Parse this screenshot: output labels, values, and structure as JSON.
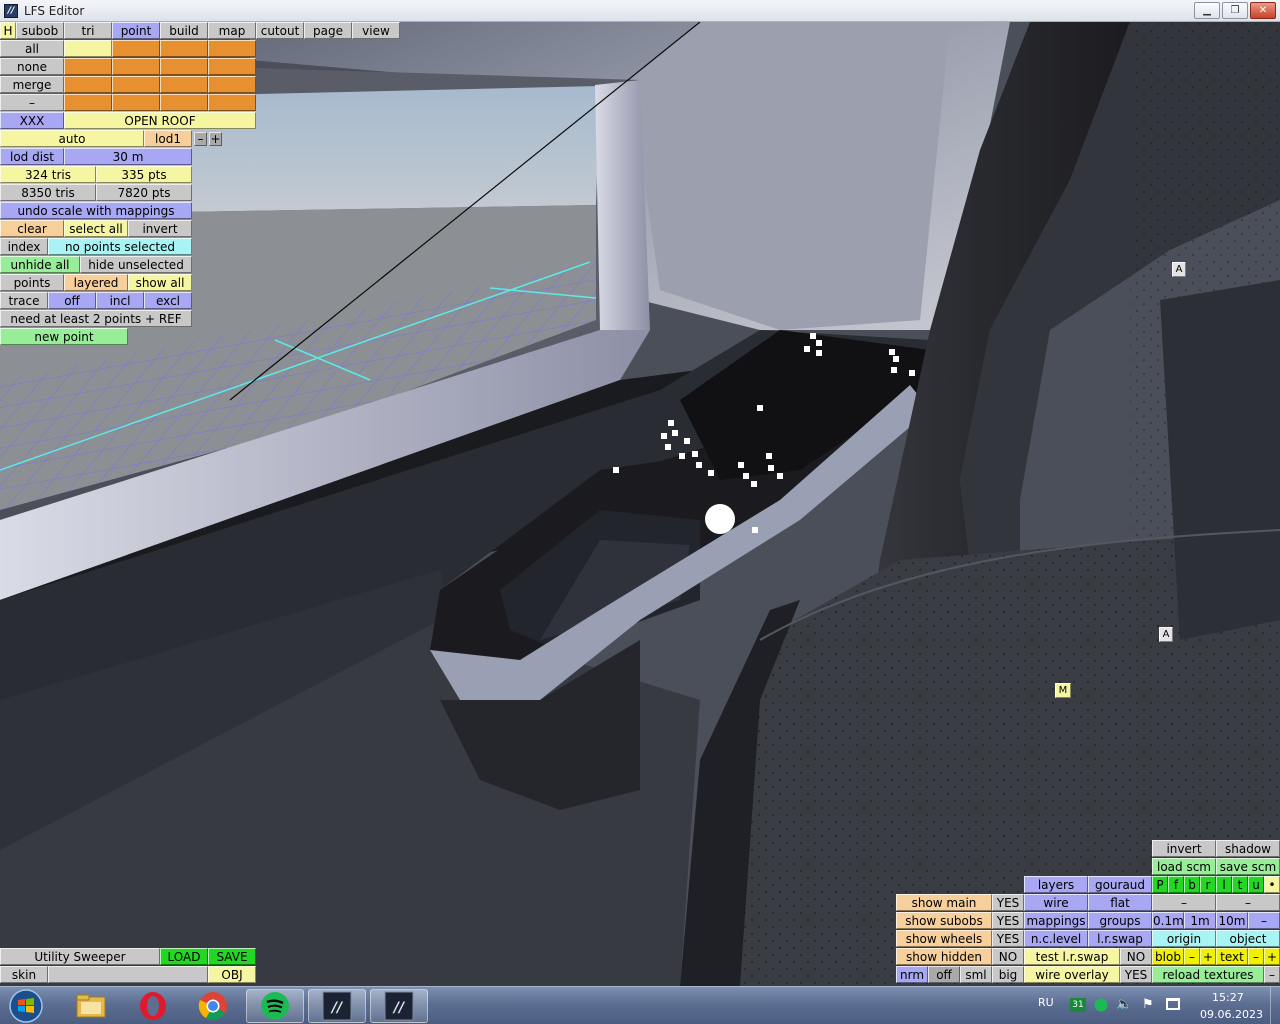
{
  "window": {
    "title": "LFS Editor"
  },
  "menu": {
    "h": "H",
    "tabs": [
      "subob",
      "tri",
      "point",
      "build",
      "map",
      "cutout",
      "page",
      "view"
    ]
  },
  "select_panel": {
    "all": "all",
    "none": "none",
    "merge": "merge",
    "dash": "–",
    "xxx": "XXX",
    "open_roof": "OPEN ROOF",
    "auto": "auto",
    "lod": "lod1",
    "minus": "–",
    "plus": "+",
    "lod_dist_label": "lod dist",
    "lod_dist_value": "30 m",
    "tris_selected": "324 tris",
    "pts_selected": "335 pts",
    "tris_total": "8350 tris",
    "pts_total": "7820 pts",
    "undo_scale": "undo scale with mappings",
    "clear": "clear",
    "select_all": "select all",
    "invert": "invert",
    "index": "index",
    "no_points": "no points selected",
    "unhide_all": "unhide all",
    "hide_unselected": "hide unselected",
    "points": "points",
    "layered": "layered",
    "show_all": "show all",
    "trace": "trace",
    "off": "off",
    "incl": "incl",
    "excl": "excl",
    "need_points": "need at least 2 points + REF",
    "new_point": "new point"
  },
  "markers": {
    "a1": "A",
    "a2": "A",
    "m": "M"
  },
  "bottom_left": {
    "utility": "Utility Sweeper",
    "load": "LOAD",
    "save": "SAVE",
    "skin": "skin",
    "obj": "OBJ"
  },
  "view_panel": {
    "invert": "invert",
    "shadow": "shadow",
    "load_scm": "load scm",
    "save_scm": "save scm",
    "letters": [
      "P",
      "f",
      "b",
      "r",
      "l",
      "t",
      "u",
      "•"
    ],
    "dash": "–",
    "layers": "layers",
    "gouraud": "gouraud",
    "show_main": "show main",
    "show_main_val": "YES",
    "wire": "wire",
    "flat": "flat",
    "show_subobs": "show subobs",
    "show_subobs_val": "YES",
    "mappings": "mappings",
    "groups": "groups",
    "grid_01": "0.1m",
    "grid_1": "1m",
    "grid_10": "10m",
    "show_wheels": "show wheels",
    "show_wheels_val": "YES",
    "nc_level": "n.c.level",
    "lr_swap": "l.r.swap",
    "origin": "origin",
    "object": "object",
    "show_hidden": "show hidden",
    "show_hidden_val": "NO",
    "test_lr_swap": "test l.r.swap",
    "test_lr_swap_val": "NO",
    "blob": "blob",
    "minus": "–",
    "plus": "+",
    "text": "text",
    "nrm": "nrm",
    "off": "off",
    "sml": "sml",
    "big": "big",
    "wire_overlay": "wire overlay",
    "wire_overlay_val": "YES",
    "reload_textures": "reload textures"
  },
  "taskbar": {
    "language": "RU",
    "time": "15:27",
    "date": "09.06.2023",
    "calendar_badge": "31",
    "apps": [
      "windows-start",
      "file-explorer",
      "opera",
      "chrome",
      "spotify",
      "lfs-editor",
      "lfs"
    ]
  }
}
